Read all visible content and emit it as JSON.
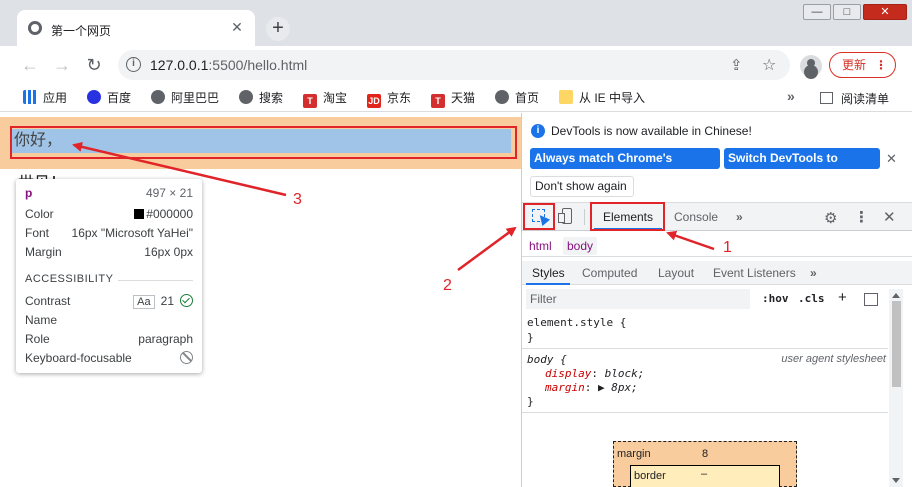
{
  "browser": {
    "tab_title": "第一个网页",
    "tab_close": "✕",
    "new_tab": "+",
    "window_buttons": {
      "minimize": "—",
      "maximize": "□",
      "close": "✕"
    },
    "url_host": "127.0.0.1",
    "url_rest": ":5500/hello.html",
    "update_label": "更新",
    "update_menu": "⋮",
    "bookmarks": [
      {
        "label": "应用",
        "icon": "apps-grid-icon"
      },
      {
        "label": "百度",
        "icon": "baidu-icon"
      },
      {
        "label": "阿里巴巴",
        "icon": "globe-icon"
      },
      {
        "label": "搜索",
        "icon": "globe-icon"
      },
      {
        "label": "淘宝",
        "icon": "taobao-icon",
        "glyph": "T"
      },
      {
        "label": "京东",
        "icon": "jd-icon",
        "glyph": "JD"
      },
      {
        "label": "天猫",
        "icon": "tmall-icon",
        "glyph": "T"
      },
      {
        "label": "首页",
        "icon": "globe-icon"
      },
      {
        "label": "从 IE 中导入",
        "icon": "folder-icon"
      }
    ],
    "bookmarks_more": "»",
    "reading_list": "阅读清单"
  },
  "page": {
    "paragraph_text": "你好，",
    "partial_text": "世见！"
  },
  "tooltip": {
    "tag": "p",
    "dimensions": "497 × 21",
    "color_label": "Color",
    "color_value": "#000000",
    "font_label": "Font",
    "font_value": "16px \"Microsoft YaHei\"",
    "margin_label": "Margin",
    "margin_value": "16px 0px",
    "accessibility_header": "ACCESSIBILITY",
    "contrast_label": "Contrast",
    "contrast_aa": "Aa",
    "contrast_value": "21",
    "name_label": "Name",
    "role_label": "Role",
    "role_value": "paragraph",
    "focusable_label": "Keyboard-focusable"
  },
  "devtools": {
    "notice_text": "DevTools is now available in Chinese!",
    "btn_match": "Always match Chrome's language",
    "btn_switch": "Switch DevTools to Chinese",
    "btn_dont": "Don't show again",
    "tabs": {
      "elements": "Elements",
      "console": "Console",
      "more": "»"
    },
    "breadcrumb": {
      "html": "html",
      "body": "body"
    },
    "style_tabs": {
      "styles": "Styles",
      "computed": "Computed",
      "layout": "Layout",
      "listeners": "Event Listeners",
      "more": "»"
    },
    "filter_placeholder": "Filter",
    "hov": ":hov",
    "cls": ".cls",
    "add": "+",
    "rules": {
      "element_selector": "element.style {",
      "element_close": "}",
      "body_selector": "body {",
      "body_origin": "user agent stylesheet",
      "body_prop1": "display",
      "body_val1": "block;",
      "body_prop2": "margin",
      "body_val2": "▶ 8px;",
      "body_close": "}"
    },
    "box_model": {
      "margin_label": "margin",
      "margin_value": "8",
      "border_label": "border",
      "border_value": "–"
    }
  },
  "annotations": {
    "n1": "1",
    "n2": "2",
    "n3": "3",
    "color": "#e0242a"
  }
}
